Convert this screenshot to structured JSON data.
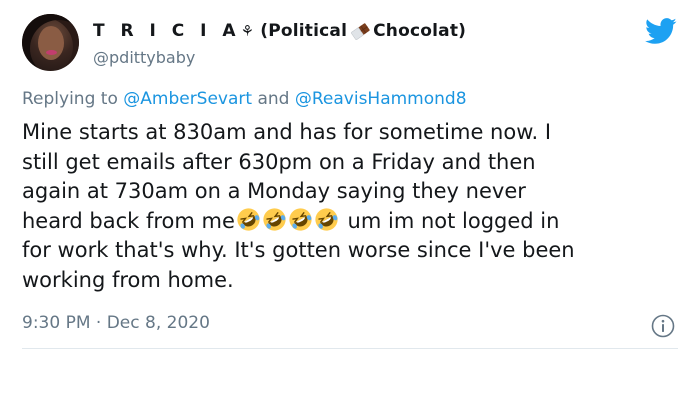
{
  "tweet": {
    "display_name_prefix": "T R I C I A",
    "display_name_glyph": "⚘",
    "display_name_open": "(Political",
    "display_name_close": "Chocolat)",
    "handle": "@pdittybaby",
    "replying_prefix": "Replying to",
    "reply_user_1": "@AmberSevart",
    "reply_and": "and",
    "reply_user_2": "@ReavisHammond8",
    "text_lines": [
      "Mine starts at 830am and has for sometime now.  I",
      "still get emails after 630pm on a Friday and then",
      "again at 730am on a Monday saying they never",
      "heard back from me",
      " um im not logged in",
      "for work that's why.  It's gotten worse since I've been",
      "working from home."
    ],
    "time": "9:30 PM",
    "separator": "·",
    "date": "Dec 8, 2020"
  },
  "icons": {
    "avatar": "profile-photo",
    "chocolate": "chocolate-bar-icon",
    "bird": "twitter-bird-icon",
    "emoji": "rolling-on-floor-laughing-emoji",
    "emoji_count": 4,
    "info": "info-icon"
  },
  "colors": {
    "text": "#14171a",
    "secondary": "#657786",
    "link": "#1b95e0",
    "twitter_blue": "#1da1f2",
    "divider": "#e1e8ed"
  }
}
